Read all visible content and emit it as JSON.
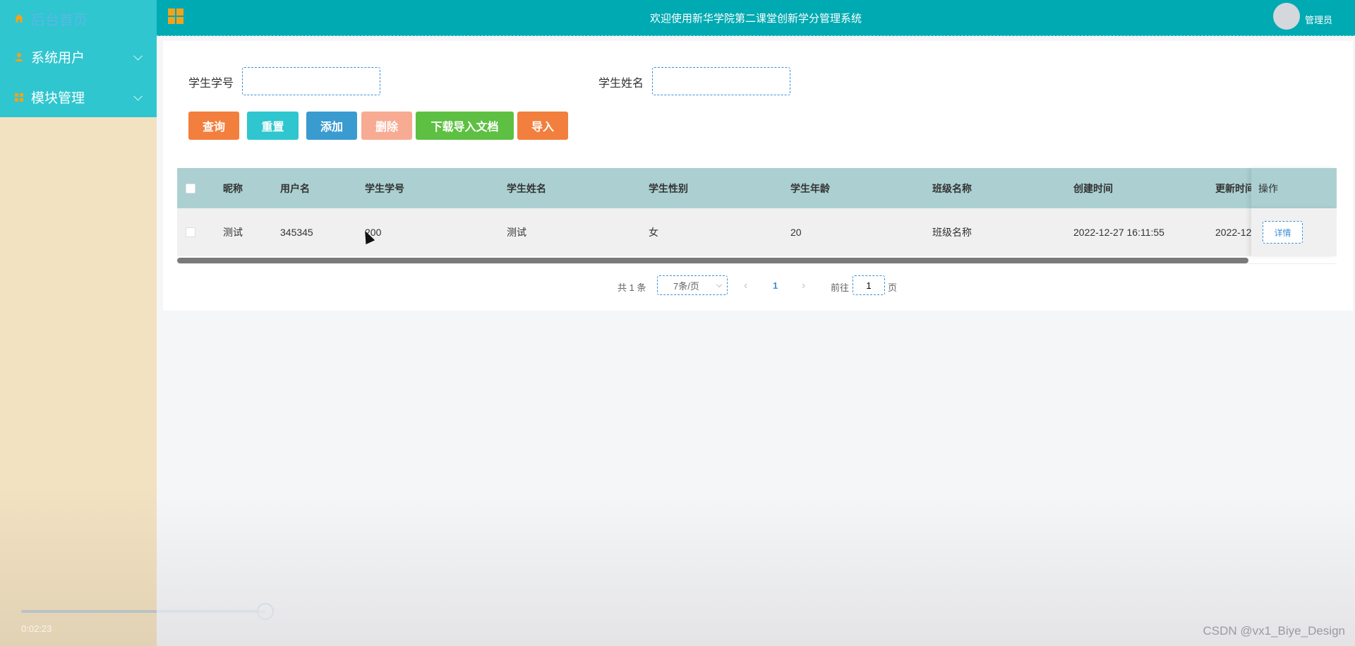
{
  "sidebar": {
    "items": [
      {
        "label": "后台首页",
        "icon": "home-icon"
      },
      {
        "label": "系统用户",
        "icon": "user-icon"
      },
      {
        "label": "模块管理",
        "icon": "module-icon"
      }
    ],
    "video_time": "0:02:23"
  },
  "header": {
    "title": "欢迎使用新华学院第二课堂创新学分管理系统",
    "user": "管理员",
    "accent_color": "#00aab2"
  },
  "search": {
    "student_id_label": "学生学号",
    "student_name_label": "学生姓名",
    "student_id_value": "",
    "student_name_value": ""
  },
  "toolbar": {
    "query": "查询",
    "reset": "重置",
    "add": "添加",
    "delete": "删除",
    "download_template": "下载导入文档",
    "import": "导入"
  },
  "table": {
    "columns": [
      "昵称",
      "用户名",
      "学生学号",
      "学生姓名",
      "学生性别",
      "学生年龄",
      "班级名称",
      "创建时间",
      "更新时间",
      "操作"
    ],
    "rows": [
      {
        "nickname": "测试",
        "username": "345345",
        "student_id": "200",
        "student_name": "测试",
        "gender": "女",
        "age": "20",
        "class_name": "班级名称",
        "created": "2022-12-27 16:11:55",
        "updated": "2022-12-",
        "action": "详情"
      }
    ]
  },
  "pager": {
    "total": "共 1 条",
    "page_size": "7条/页",
    "current_page": "1",
    "goto_label": "前往",
    "goto_value": "1",
    "page_unit": "页"
  },
  "watermark": "CSDN @vx1_Biye_Design"
}
